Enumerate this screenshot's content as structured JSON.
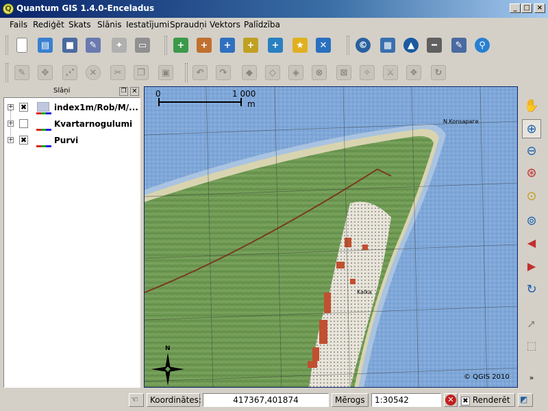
{
  "window": {
    "title": "Quantum GIS 1.4.0-Enceladus",
    "app_icon": "qgis-logo-icon",
    "buttons": {
      "minimize": "_",
      "maximize": "□",
      "close": "×"
    }
  },
  "menubar": {
    "items": [
      "Fails",
      "Rediģēt",
      "Skats",
      "Slānis",
      "Iestatījumi",
      "Spraudņi",
      "Vektors",
      "Palīdzība"
    ]
  },
  "layers_panel": {
    "title": "Slāņi",
    "layers": [
      {
        "name": "index1m/Rob/M/...",
        "checked": true,
        "expanded": false,
        "checkmark": "✖"
      },
      {
        "name": "Kvartarnogulumi",
        "checked": false,
        "expanded": false,
        "checkmark": ""
      },
      {
        "name": "Purvi",
        "checked": true,
        "expanded": false,
        "checkmark": "✖"
      }
    ]
  },
  "map": {
    "scalebar_start": "0",
    "scalebar_end": "1 000",
    "scalebar_unit": "m",
    "copyright": "© QGIS 2010",
    "north_arrow_label": "N",
    "water_color": "#7fa7d8",
    "land_color": "#6f9a54",
    "sand_color": "#d8d4b0",
    "town_color": "#c05030",
    "place_labels": [
      "N.Konsaрагe",
      "Kalka"
    ]
  },
  "statusbar": {
    "coord_label": "Koordinātes:",
    "coord_value": "417367,401874",
    "scale_label": "Mērogs",
    "scale_value": "1:30542",
    "render_label": "Renderēt",
    "render_checkmark": "✖"
  },
  "colors": {
    "titlebar": "#0a246a",
    "chrome": "#d4d0c8",
    "selection_border": "#0a246a"
  }
}
